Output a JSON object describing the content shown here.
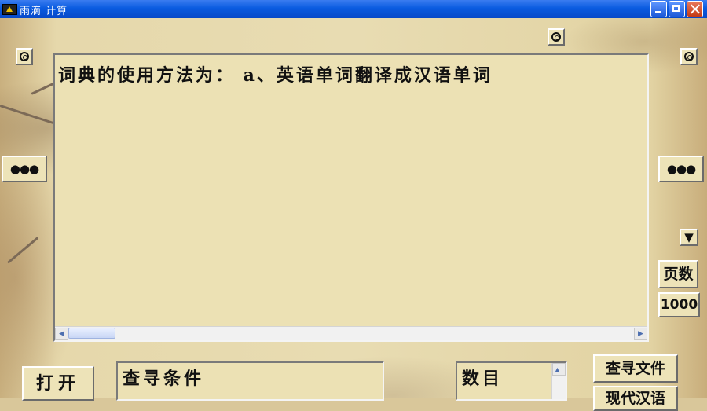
{
  "window": {
    "title": "雨滴  计算"
  },
  "panel": {
    "text": "词典的使用方法为：      a、英语单词翻译成汉语单词"
  },
  "side": {
    "left_dots": "●●●",
    "right_dots": "●●●",
    "down_arrow": "▼",
    "page_label": "页数",
    "page_count": "1000"
  },
  "bottom": {
    "open_label": "打开",
    "search_label": "查寻条件",
    "count_label": "数目",
    "find_file_label": "查寻文件",
    "partial_label": "现代汉语"
  },
  "colors": {
    "titlebar": "#0a5be0",
    "panel_bg": "#ece1b4",
    "parchment": "#e8dcb2"
  }
}
